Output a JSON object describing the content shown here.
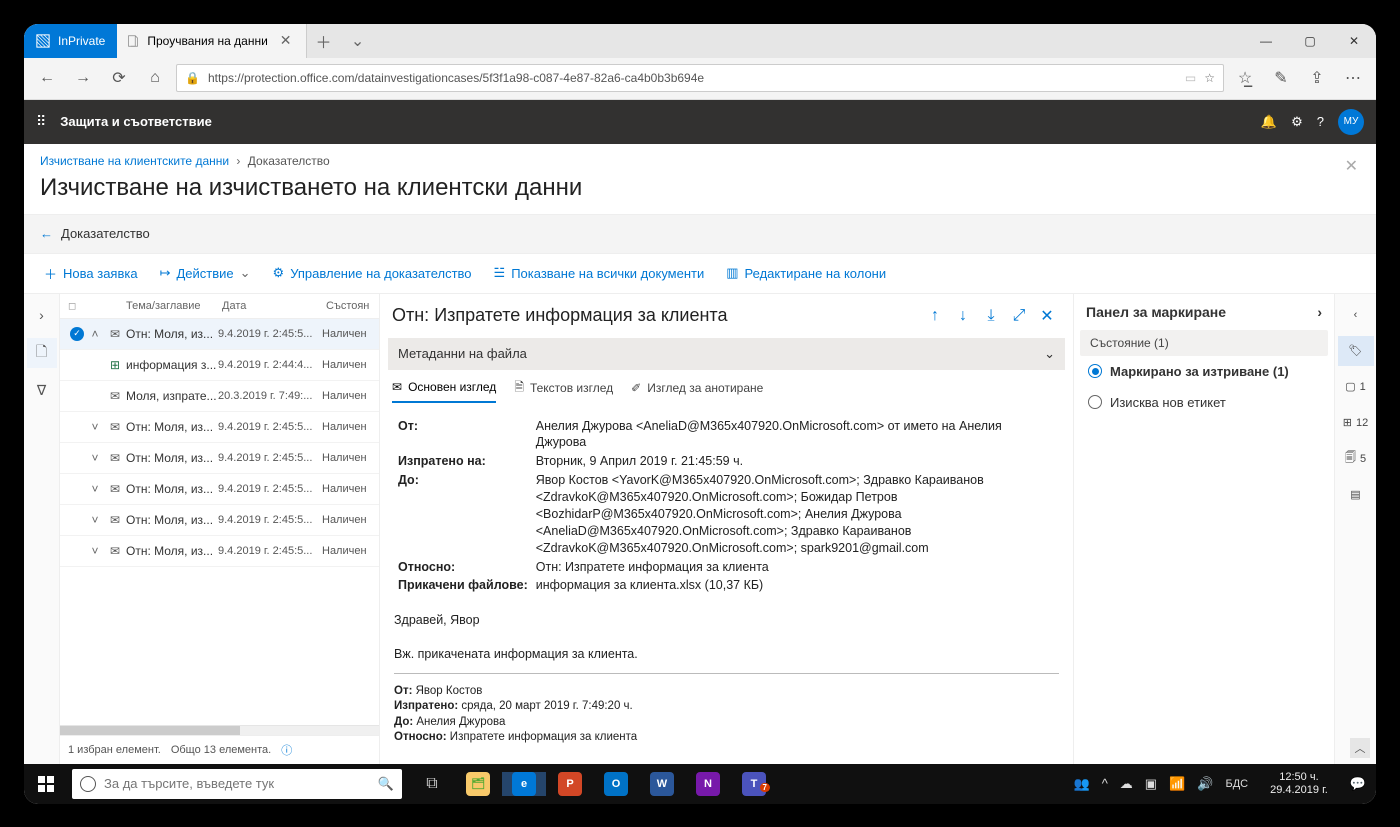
{
  "browser": {
    "inprivate": "InPrivate",
    "tab_title": "Проучвания на данни",
    "url": "https://protection.office.com/datainvestigationcases/5f3f1a98-c087-4e87-82a6-ca4b0b3b694e"
  },
  "appbar": {
    "title": "Защита и съответствие",
    "avatar": "МУ"
  },
  "breadcrumbs": {
    "root": "Изчистване на клиентските данни",
    "current": "Доказателство"
  },
  "page_title": "Изчистване на изчистването на клиентски данни",
  "back_label": "Доказателство",
  "commands": {
    "new": "Нова заявка",
    "action": "Действие",
    "manage": "Управление на доказателство",
    "showall": "Показване на всички документи",
    "editcols": "Редактиране на колони"
  },
  "list": {
    "headers": {
      "subject": "Тема/заглавие",
      "date": "Дата",
      "status": "Състоян"
    },
    "rows": [
      {
        "sel": true,
        "chv": "up",
        "type": "mail",
        "subject": "Отн: Моля, из...",
        "date": "9.4.2019 г. 2:45:5...",
        "status": "Наличен"
      },
      {
        "sel": false,
        "chv": "",
        "type": "xlsx",
        "subject": "информация з...",
        "date": "9.4.2019 г. 2:44:4...",
        "status": "Наличен"
      },
      {
        "sel": false,
        "chv": "",
        "type": "mail",
        "subject": "Моля, изпрате...",
        "date": "20.3.2019 г. 7:49:...",
        "status": "Наличен"
      },
      {
        "sel": false,
        "chv": "down",
        "type": "mail",
        "subject": "Отн: Моля, из...",
        "date": "9.4.2019 г. 2:45:5...",
        "status": "Наличен"
      },
      {
        "sel": false,
        "chv": "down",
        "type": "mail",
        "subject": "Отн: Моля, из...",
        "date": "9.4.2019 г. 2:45:5...",
        "status": "Наличен"
      },
      {
        "sel": false,
        "chv": "down",
        "type": "mail",
        "subject": "Отн: Моля, из...",
        "date": "9.4.2019 г. 2:45:5...",
        "status": "Наличен"
      },
      {
        "sel": false,
        "chv": "down",
        "type": "mail",
        "subject": "Отн: Моля, из...",
        "date": "9.4.2019 г. 2:45:5...",
        "status": "Наличен"
      },
      {
        "sel": false,
        "chv": "down",
        "type": "mail",
        "subject": "Отн: Моля, из...",
        "date": "9.4.2019 г. 2:45:5...",
        "status": "Наличен"
      }
    ],
    "footer_selected": "1 избран елемент.",
    "footer_total": "Общо 13 елемента."
  },
  "detail": {
    "title": "Отн: Изпратете информация за клиента",
    "meta_label": "Метаданни на файла",
    "tabs": {
      "native": "Основен изглед",
      "text": "Текстов изглед",
      "annotate": "Изглед за анотиране"
    },
    "fields": {
      "from_l": "От:",
      "from_v": "Анелия Джурова <AneliaD@M365x407920.OnMicrosoft.com> от името на Анелия Джурова",
      "sent_l": "Изпратено на:",
      "sent_v": "Вторник, 9 Април 2019 г. 21:45:59 ч.",
      "to_l": "До:",
      "to_v": "Явор Костов <YavorK@M365x407920.OnMicrosoft.com>; Здравко Караиванов <ZdravkoK@M365x407920.OnMicrosoft.com>; Божидар Петров <BozhidarP@M365x407920.OnMicrosoft.com>; Анелия Джурова <AneliaD@M365x407920.OnMicrosoft.com>; Здравко Караиванов <ZdravkoK@M365x407920.OnMicrosoft.com>; spark9201@gmail.com",
      "subj_l": "Относно:",
      "subj_v": "Отн: Изпратете информация за клиента",
      "att_l": "Прикачени файлове:",
      "att_v": "информация за клиента.xlsx (10,37 КБ)"
    },
    "body": {
      "greet": "Здравей, Явор",
      "line": "Вж. прикачената информация за клиента."
    },
    "quoted": {
      "from_l": "От:",
      "from_v": "Явор Костов",
      "sent_l": "Изпратено:",
      "sent_v": "сряда, 20 март 2019 г. 7:49:20 ч.",
      "to_l": "До:",
      "to_v": "Анелия Джурова",
      "subj_l": "Относно:",
      "subj_v": "Изпратете информация за клиента"
    }
  },
  "tagging": {
    "title": "Панел за маркиране",
    "group": "Състояние (1)",
    "opt1": "Маркирано за изтриване (1)",
    "opt2": "Изисква нов етикет"
  },
  "rightrail": {
    "c1": "1",
    "c2": "12",
    "c3": "5"
  },
  "taskbar": {
    "search_placeholder": "За да търсите, въведете тук",
    "time": "12:50 ч.",
    "date": "29.4.2019 г."
  }
}
